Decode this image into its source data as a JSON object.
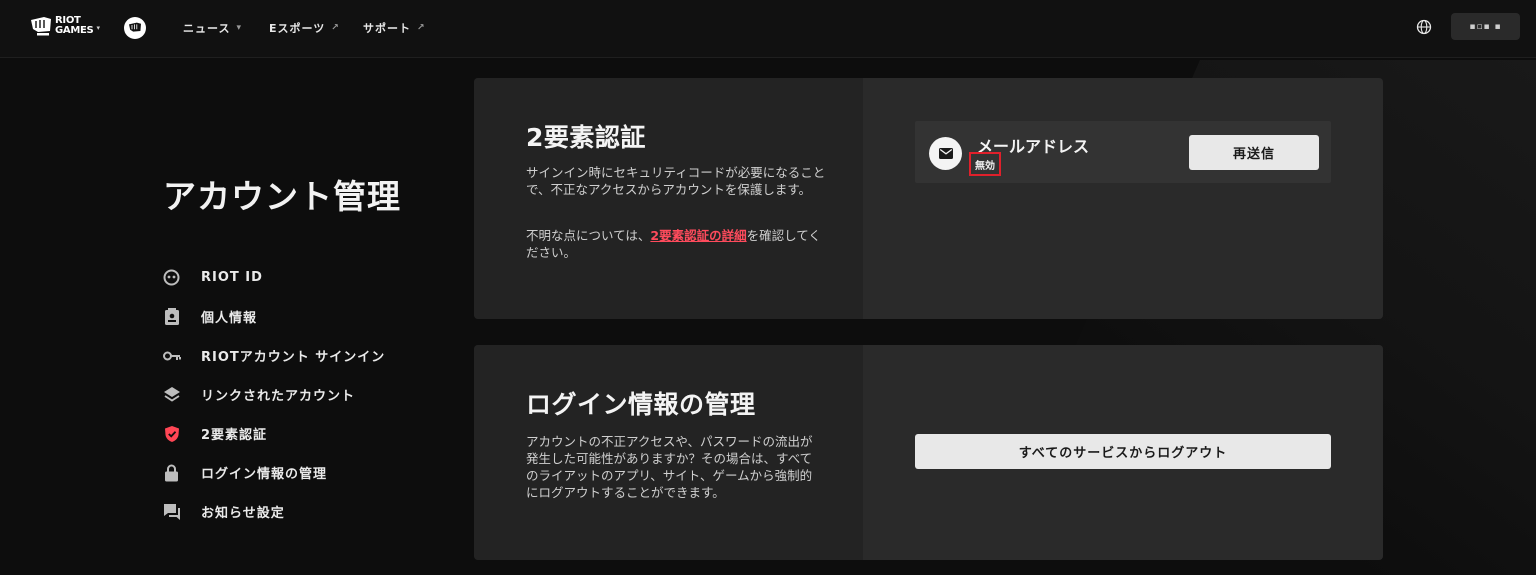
{
  "nav": {
    "logo_text_line1": "RIOT",
    "logo_text_line2": "GAMES",
    "logo_caret": "▾",
    "items": [
      {
        "label": "ニュース",
        "symbol": "▾"
      },
      {
        "label": "Eスポーツ",
        "symbol": "↗"
      },
      {
        "label": "サポート",
        "symbol": "↗"
      }
    ],
    "user_chip": "▪▫▪ ▪"
  },
  "sidebar": {
    "title": "アカウント管理",
    "items": [
      {
        "label": "RIOT ID",
        "icon": "riot-id-icon"
      },
      {
        "label": "個人情報",
        "icon": "id-card-icon"
      },
      {
        "label": "RIOTアカウント サインイン",
        "icon": "key-icon"
      },
      {
        "label": "リンクされたアカウント",
        "icon": "layers-icon"
      },
      {
        "label": "2要素認証",
        "icon": "shield-icon",
        "active": true
      },
      {
        "label": "ログイン情報の管理",
        "icon": "lock-icon"
      },
      {
        "label": "お知らせ設定",
        "icon": "chat-icon"
      }
    ]
  },
  "two_factor": {
    "title": "2要素認証",
    "description": "サインイン時にセキュリティコードが必要になることで、不正なアクセスからアカウントを保護します。",
    "help_prefix": "不明な点については、",
    "help_link": "2要素認証の詳細",
    "help_suffix": "を確認してください。",
    "email_label": "メールアドレス",
    "status": "無効",
    "resend_label": "再送信"
  },
  "login_management": {
    "title": "ログイン情報の管理",
    "description": "アカウントの不正アクセスや、パスワードの流出が発生した可能性がありますか？その場合は、すべてのライアットのアプリ、サイト、ゲームから強制的にログアウトすることができます。",
    "logout_label": "すべてのサービスからログアウト"
  },
  "colors": {
    "accent_red": "#ff4b5c",
    "highlight_border": "#e0202b",
    "active_icon": "#ff4655"
  }
}
